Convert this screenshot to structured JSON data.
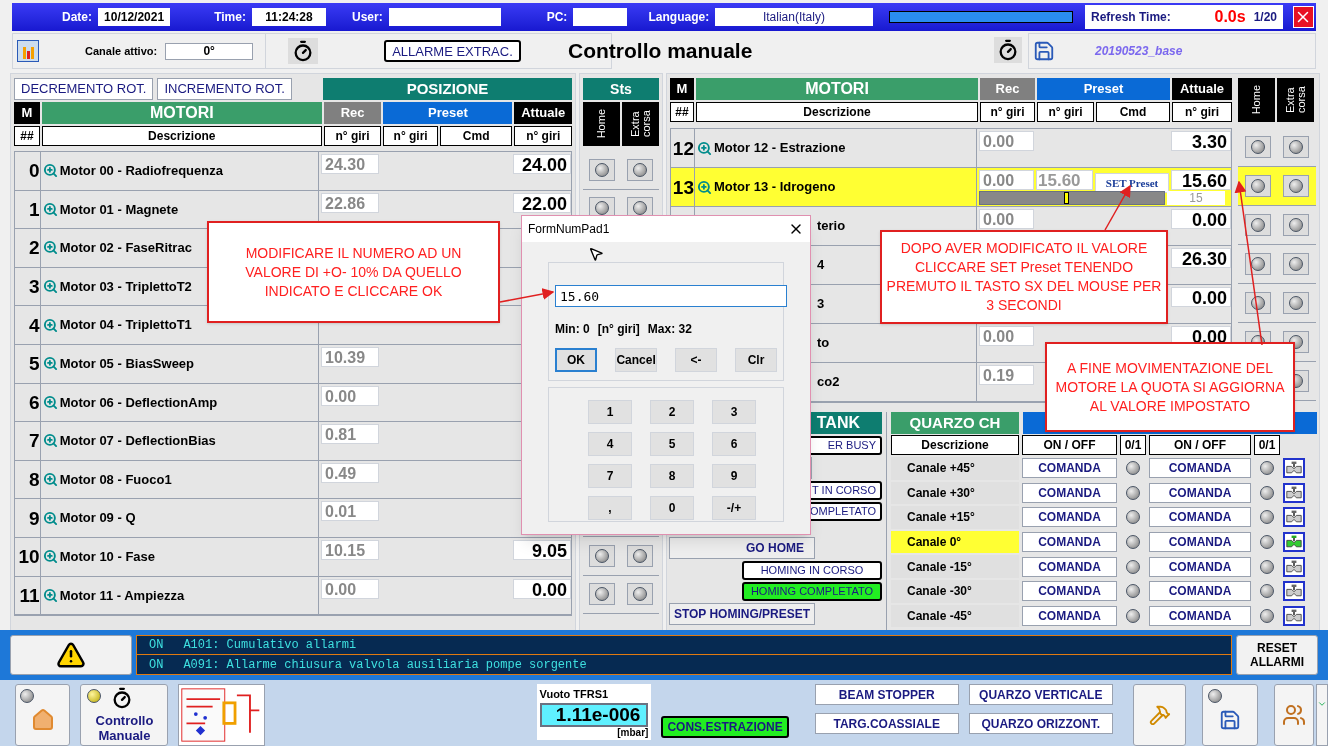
{
  "top_bar": {
    "date_label": "Date:",
    "date": "10/12/2021",
    "time_label": "Time:",
    "time": "11:24:28",
    "user_label": "User:",
    "pc_label": "PC:",
    "language_label": "Language:",
    "language": "Italian(Italy)",
    "progress": {
      "level": 1
    },
    "refresh_label": "Refresh Time:",
    "refresh": "0.0s",
    "page": "1/20"
  },
  "header": {
    "channel_label": "Canale attivo:",
    "channel": "0°",
    "alarm_button": "ALLARME EXTRAC.",
    "title": "Controllo manuale",
    "config": "20190523_base"
  },
  "left_panel": {
    "buttons": [
      "DECREMENTO ROT.",
      "INCREMENTO ROT."
    ],
    "group_header": "POSIZIONE",
    "sts_header": "Sts",
    "headers": {
      "m": "M",
      "motors": "MOTORI",
      "rec": "Rec",
      "preset": "Preset",
      "actual": "Attuale",
      "num": "##",
      "desc": "Descrizione",
      "rec_unit": "n° giri",
      "preset_unit": "n° giri",
      "cmd": "Cmd",
      "actual_unit": "n° giri",
      "home": "Home",
      "extra": "Extra corsa"
    },
    "rows": [
      {
        "num": "0",
        "name": "Motor 00 - Radiofrequenza",
        "rec": "24.30",
        "actual": "24.00",
        "highlighted": false
      },
      {
        "num": "1",
        "name": "Motor 01 - Magnete",
        "rec": "22.86",
        "actual": "22.00",
        "highlighted": false
      },
      {
        "num": "2",
        "name": "Motor 02 - FaseRitrac",
        "highlighted": false
      },
      {
        "num": "3",
        "name": "Motor 03 - TriplettoT2",
        "highlighted": false
      },
      {
        "num": "4",
        "name": "Motor 04 - TriplettoT1",
        "highlighted": false
      },
      {
        "num": "5",
        "name": "Motor 05 - BiasSweep",
        "rec": "10.39",
        "highlighted": false
      },
      {
        "num": "6",
        "name": "Motor 06 - DeflectionAmp",
        "rec": "0.00",
        "highlighted": false
      },
      {
        "num": "7",
        "name": "Motor 07 - DeflectionBias",
        "rec": "0.81",
        "highlighted": false
      },
      {
        "num": "8",
        "name": "Motor 08 - Fuoco1",
        "rec": "0.49",
        "highlighted": false
      },
      {
        "num": "9",
        "name": "Motor 09 - Q",
        "rec": "0.01",
        "highlighted": false
      },
      {
        "num": "10",
        "name": "Motor 10 - Fase",
        "rec": "10.15",
        "actual": "9.05",
        "highlighted": false
      },
      {
        "num": "11",
        "name": "Motor 11 - Ampiezza",
        "rec": "0.00",
        "actual": "0.00",
        "highlighted": false
      }
    ]
  },
  "right_panel": {
    "headers": {
      "m": "M",
      "motors": "MOTORI",
      "rec": "Rec",
      "preset": "Preset",
      "actual": "Attuale",
      "num": "##",
      "desc": "Descrizione",
      "rec_unit": "n° giri",
      "preset_unit": "n° giri",
      "cmd": "Cmd",
      "actual_unit": "n° giri",
      "home": "Home",
      "extra": "Extra corsa"
    },
    "rows": [
      {
        "num": "12",
        "name": "Motor 12 - Estrazione",
        "rec": "0.00",
        "actual": "3.30",
        "highlighted": false,
        "covered": false
      },
      {
        "num": "13",
        "name": "Motor 13 - Idrogeno",
        "rec": "0.00",
        "preset": "15.60",
        "cmd": "SET Preset",
        "actual": "15.60",
        "slider": {
          "level": 0.47,
          "label": "15"
        },
        "highlighted": true,
        "covered": false
      },
      {
        "name": "terio",
        "rec": "0.00",
        "actual": "0.00",
        "highlighted": false,
        "covered": true
      },
      {
        "name": "4",
        "actual": "26.30",
        "highlighted": false,
        "covered": true
      },
      {
        "name": "3",
        "actual": "0.00",
        "highlighted": false,
        "covered": true
      },
      {
        "name": "to",
        "rec": "0.00",
        "actual": "0.00",
        "highlighted": false,
        "covered": true
      },
      {
        "name": "co2",
        "rec": "0.19",
        "highlighted": false,
        "covered": true
      }
    ]
  },
  "tank_panel": {
    "header": "TANK",
    "items": [
      {
        "kind": "status",
        "text": "ER BUSY",
        "active": false
      },
      {
        "kind": "button"
      },
      {
        "kind": "status",
        "text": "T IN CORSO",
        "active": false
      },
      {
        "kind": "status",
        "text": "OMPLETATO",
        "active": false
      },
      {
        "kind": "button",
        "text": "GO HOME"
      },
      {
        "kind": "status",
        "text": "HOMING IN CORSO",
        "active": false
      },
      {
        "kind": "status",
        "text": "HOMING COMPLETATO",
        "active": true
      },
      {
        "kind": "button",
        "text": "STOP HOMING/PRESET"
      }
    ]
  },
  "quartz_panel": {
    "header": "QUARZO CH",
    "columns": [
      "Descrizione",
      "ON / OFF",
      "0/1",
      "ON / OFF",
      "0/1"
    ],
    "rows": [
      {
        "label": "Canale +45°",
        "cmd1": "COMANDA",
        "cmd2": "COMANDA",
        "selected": false
      },
      {
        "label": "Canale +30°",
        "cmd1": "COMANDA",
        "cmd2": "COMANDA",
        "selected": false
      },
      {
        "label": "Canale +15°",
        "cmd1": "COMANDA",
        "cmd2": "COMANDA",
        "selected": false
      },
      {
        "label": "Canale 0°",
        "cmd1": "COMANDA",
        "cmd2": "COMANDA",
        "selected": true
      },
      {
        "label": "Canale -15°",
        "cmd1": "COMANDA",
        "cmd2": "COMANDA",
        "selected": false
      },
      {
        "label": "Canale -30°",
        "cmd1": "COMANDA",
        "cmd2": "COMANDA",
        "selected": false
      },
      {
        "label": "Canale -45°",
        "cmd1": "COMANDA",
        "cmd2": "COMANDA",
        "selected": false
      }
    ]
  },
  "dialog": {
    "title": "FormNumPad1",
    "value": "15.60",
    "min": "Min: 0",
    "unit": "[n° giri]",
    "max": "Max: 32",
    "actions": [
      {
        "label": "OK",
        "default": true
      },
      {
        "label": "Cancel",
        "default": false
      },
      {
        "label": "<-",
        "default": false
      },
      {
        "label": "Clr",
        "default": false
      }
    ],
    "keys": [
      "1",
      "2",
      "3",
      "4",
      "5",
      "6",
      "7",
      "8",
      "9",
      ",",
      "0",
      "-/+"
    ]
  },
  "callouts": [
    "MODIFICARE IL NUMERO AD UN VALORE DI +O- 10% DA QUELLO INDICATO E CLICCARE OK",
    "DOPO AVER MODIFICATO IL VALORE CLICCARE SET Preset TENENDO PREMUTO IL TASTO SX DEL MOUSE PER 3 SECONDI",
    "A FINE MOVIMENTAZIONE DEL MOTORE LA QUOTA SI AGGIORNA AL VALORE IMPOSTATO"
  ],
  "alarms": {
    "rows": [
      {
        "state": "ON",
        "text": "A101: Cumulativo allarmi"
      },
      {
        "state": "ON",
        "text": "A091: Allarme chiusura valvola ausiliaria pompe sorgente"
      }
    ],
    "reset": "RESET ALLARMI"
  },
  "bottom_bar": {
    "home_lit": false,
    "manual": {
      "text": "Controllo Manuale",
      "lit": true
    },
    "vacuum": {
      "title": "Vuoto TFRS1",
      "value": "1.11e-006",
      "unit": "[mbar]"
    },
    "extraction": {
      "text": "CONS.ESTRAZIONE",
      "active": true
    },
    "buttons": [
      "BEAM STOPPER",
      "QUARZO VERTICALE",
      "TARG.COASSIALE",
      "QUARZO ORIZZONT."
    ],
    "save_lit": false
  }
}
